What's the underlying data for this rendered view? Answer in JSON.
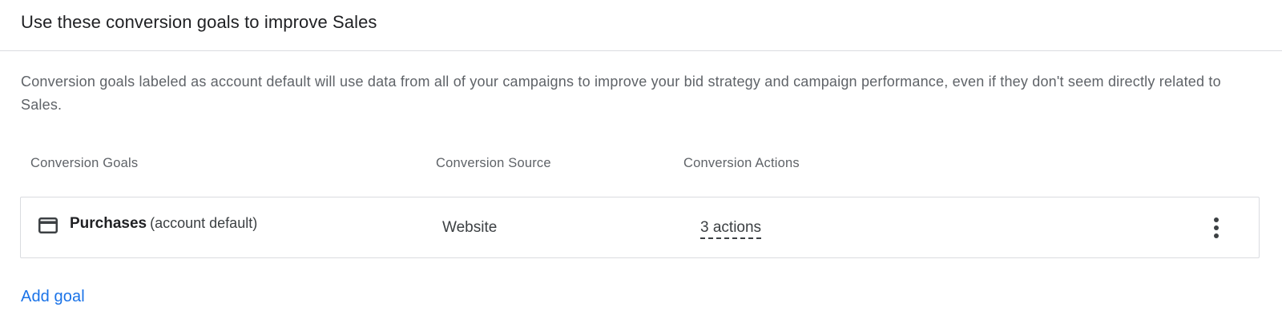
{
  "header": {
    "title": "Use these conversion goals to improve Sales"
  },
  "description": "Conversion goals labeled as account default will use data from all of your campaigns to improve your bid strategy and campaign performance, even if they don't seem directly related to Sales.",
  "table": {
    "columns": {
      "goals": "Conversion Goals",
      "source": "Conversion Source",
      "actions": "Conversion Actions"
    },
    "rows": [
      {
        "icon": "credit-card-icon",
        "name": "Purchases",
        "suffix": "(account default)",
        "source": "Website",
        "actions": "3 actions",
        "menu_icon": "more-vert-icon"
      }
    ]
  },
  "footer": {
    "add_goal_label": "Add goal"
  },
  "colors": {
    "link": "#1a73e8",
    "border": "#dadce0",
    "secondary_text": "#5f6368",
    "primary_text": "#202124"
  }
}
